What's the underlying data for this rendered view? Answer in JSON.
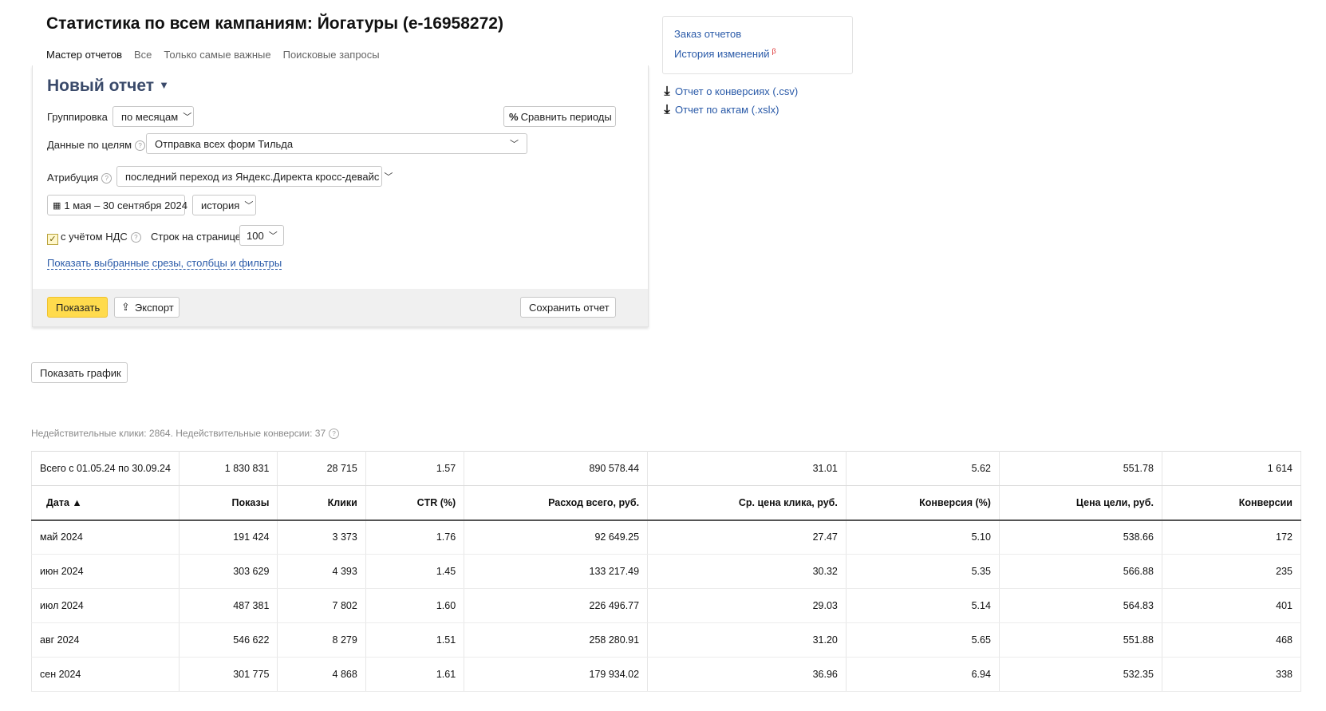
{
  "page": {
    "title": "Статистика по всем кампаниям: Йогатуры (e-16958272)",
    "tabs": [
      "Мастер отчетов",
      "Все",
      "Только самые важные",
      "Поисковые запросы"
    ]
  },
  "report": {
    "title": "Новый отчет",
    "grouping_label": "Группировка",
    "grouping_value": "по месяцам",
    "compare_button": "Сравнить периоды",
    "goals_label": "Данные по целям",
    "goals_value": "Отправка всех форм Тильда",
    "attribution_label": "Атрибуция",
    "attribution_value": "последний переход из Яндекс.Директа кросс-девайс",
    "date_range": "1 мая – 30 сентября 2024",
    "history_value": "история",
    "vat_label": "с учётом НДС",
    "vat_checked": true,
    "rows_label": "Строк на странице",
    "rows_value": "100",
    "show_slices_link": "Показать выбранные срезы, столбцы и фильтры",
    "show_button": "Показать",
    "export_button": "Экспорт",
    "save_button": "Сохранить отчет"
  },
  "side": {
    "order_reports": "Заказ отчетов",
    "history_changes": "История изменений",
    "beta": "β",
    "conversions_csv": "Отчет о конверсиях (.csv)",
    "acts_xlsx": "Отчет по актам (.xslx)"
  },
  "show_chart_button": "Показать график",
  "invalid_note": "Недействительные клики: 2864. Недействительные конверсии: 37",
  "table": {
    "totals": [
      "Всего с 01.05.24 по 30.09.24",
      "1 830 831",
      "28 715",
      "1.57",
      "890 578.44",
      "31.01",
      "5.62",
      "551.78",
      "1 614"
    ],
    "headers": [
      "Дата ▲",
      "Показы",
      "Клики",
      "CTR (%)",
      "Расход всего, руб.",
      "Ср. цена клика, руб.",
      "Конверсия (%)",
      "Цена цели, руб.",
      "Конверсии"
    ],
    "rows": [
      [
        "май 2024",
        "191 424",
        "3 373",
        "1.76",
        "92 649.25",
        "27.47",
        "5.10",
        "538.66",
        "172"
      ],
      [
        "июн 2024",
        "303 629",
        "4 393",
        "1.45",
        "133 217.49",
        "30.32",
        "5.35",
        "566.88",
        "235"
      ],
      [
        "июл 2024",
        "487 381",
        "7 802",
        "1.60",
        "226 496.77",
        "29.03",
        "5.14",
        "564.83",
        "401"
      ],
      [
        "авг 2024",
        "546 622",
        "8 279",
        "1.51",
        "258 280.91",
        "31.20",
        "5.65",
        "551.88",
        "468"
      ],
      [
        "сен 2024",
        "301 775",
        "4 868",
        "1.61",
        "179 934.02",
        "36.96",
        "6.94",
        "532.35",
        "338"
      ]
    ]
  }
}
